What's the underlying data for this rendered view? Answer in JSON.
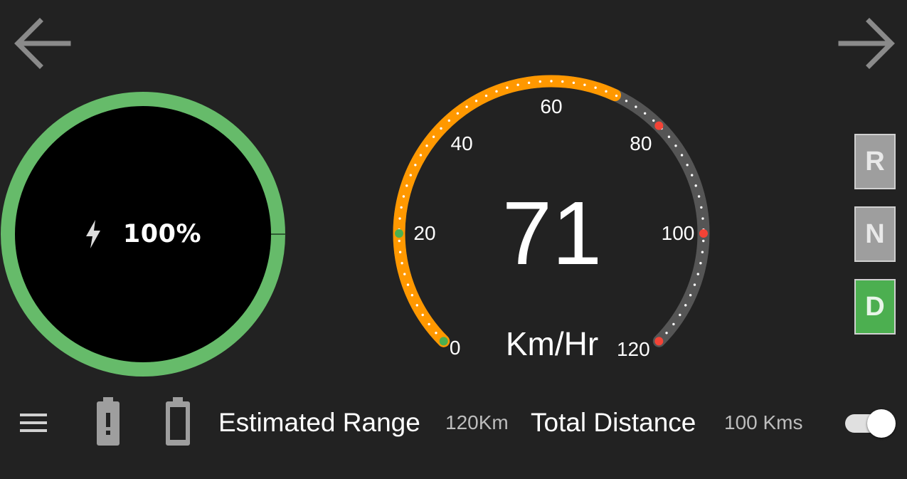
{
  "colors": {
    "background": "#222222",
    "battery_ring": "#66bb6a",
    "speed_arc_active": "#ff9800",
    "speed_arc_inactive": "#555555",
    "marker_green": "#4caf50",
    "marker_red": "#f44336",
    "gear_active": "#4caf50",
    "gear_inactive": "#9e9e9e"
  },
  "nav": {
    "back_icon": "arrow-left-icon",
    "forward_icon": "arrow-right-icon"
  },
  "battery": {
    "icon": "bolt-icon",
    "percent_text": "100%",
    "level": 1.0
  },
  "speedometer": {
    "value": "71",
    "unit": "Km/Hr",
    "min": 0,
    "max": 120,
    "ticks": [
      "0",
      "20",
      "40",
      "60",
      "80",
      "100",
      "120"
    ],
    "current_fill": 71,
    "green_markers": [
      0,
      20
    ],
    "red_markers": [
      80,
      100,
      120
    ]
  },
  "gears": [
    {
      "label": "R",
      "active": false
    },
    {
      "label": "N",
      "active": false
    },
    {
      "label": "D",
      "active": true
    }
  ],
  "bottom_bar": {
    "menu_icon": "menu-icon",
    "battery_alert_icon": "battery-alert-icon",
    "battery_icon": "battery-icon",
    "range_label": "Estimated Range",
    "range_value": "120Km",
    "distance_label": "Total Distance",
    "distance_value": "100 Kms",
    "toggle_on": true
  }
}
